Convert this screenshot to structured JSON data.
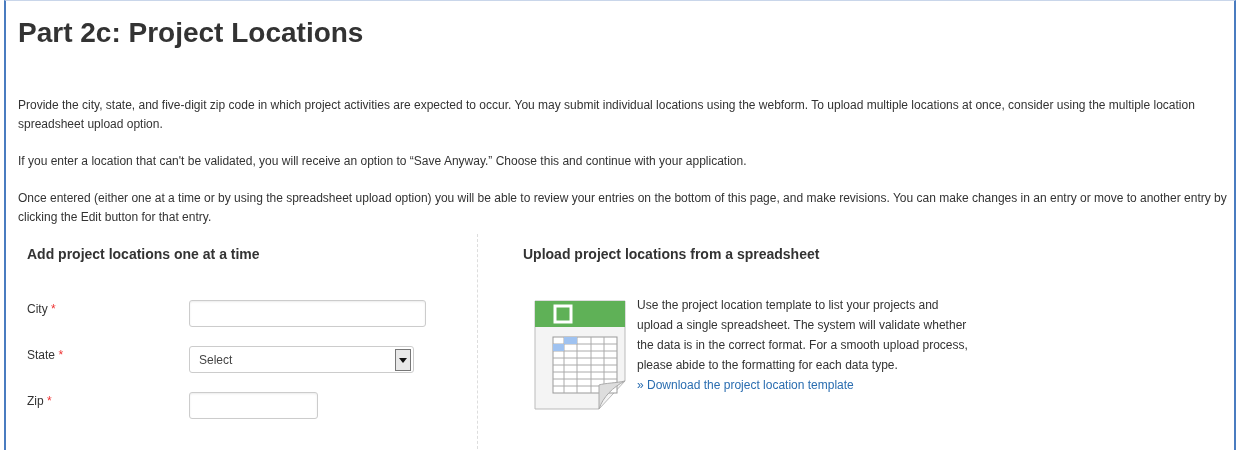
{
  "title": "Part 2c: Project Locations",
  "paragraphs": [
    "Provide the city, state, and five-digit zip code in which project activities are expected to occur. You may submit individual locations using the webform. To upload multiple locations at once, consider using the multiple location spreadsheet upload option.",
    "If you enter a location that can't be validated, you will receive an option to “Save Anyway.” Choose this and continue with your application.",
    "Once entered (either one at a time or by using the spreadsheet upload option) you will be able to review your entries on the bottom of this page, and make revisions. You can make changes in an entry or move to another entry by clicking the Edit button for that entry."
  ],
  "manual_section": {
    "heading": "Add project locations one at a time",
    "fields": [
      {
        "label": "City",
        "required_mark": "*",
        "kind": "text"
      },
      {
        "label": "State",
        "required_mark": "*",
        "kind": "select",
        "value": "Select"
      },
      {
        "label": "Zip",
        "required_mark": "*",
        "kind": "zip"
      }
    ]
  },
  "upload_section": {
    "heading": "Upload project locations from a spreadsheet",
    "description": "Use the project location template to list your projects and upload a single spreadsheet. The system will validate whether the data is in the correct format. For a smooth upload process, please abide to the formatting for each data type.",
    "link": "» Download the project location template"
  }
}
